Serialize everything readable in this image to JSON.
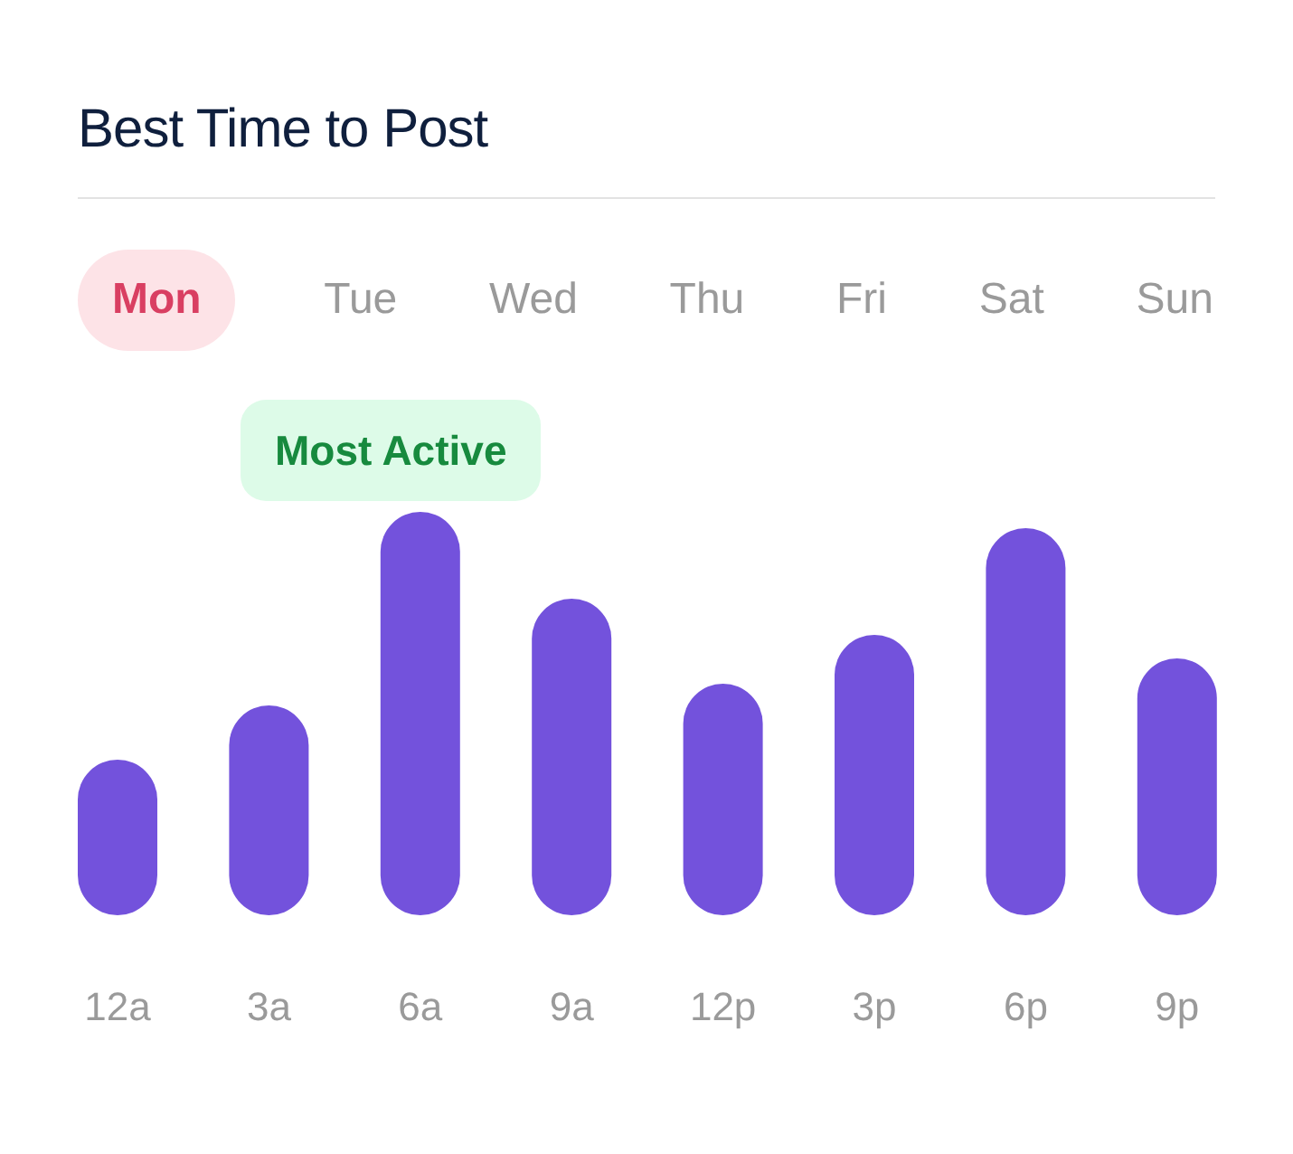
{
  "title": "Best Time to Post",
  "days": [
    {
      "label": "Mon",
      "selected": true
    },
    {
      "label": "Tue",
      "selected": false
    },
    {
      "label": "Wed",
      "selected": false
    },
    {
      "label": "Thu",
      "selected": false
    },
    {
      "label": "Fri",
      "selected": false
    },
    {
      "label": "Sat",
      "selected": false
    },
    {
      "label": "Sun",
      "selected": false
    }
  ],
  "badge": "Most Active",
  "time_labels": [
    "12a",
    "3a",
    "6a",
    "9a",
    "12p",
    "3p",
    "6p",
    "9p"
  ]
}
